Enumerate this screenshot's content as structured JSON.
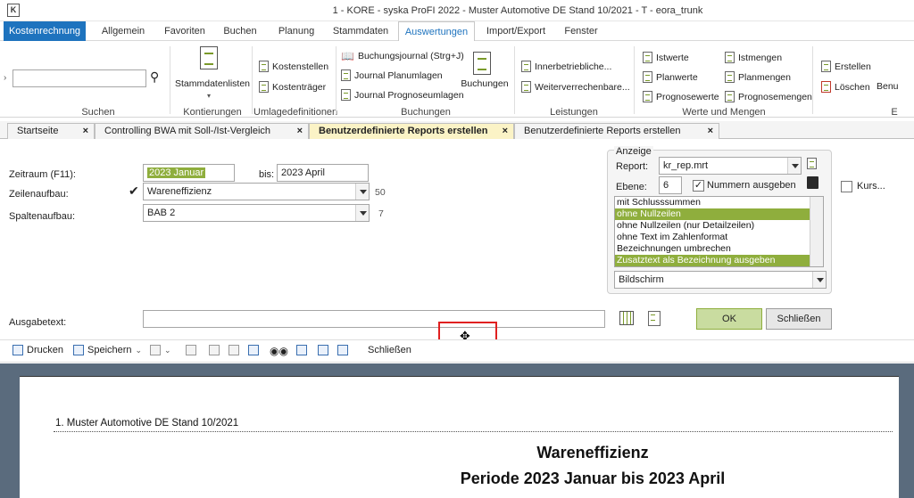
{
  "window": {
    "title": "1 - KORE - syska ProFI 2022 - Muster Automotive DE Stand 10/2021 - T - eora_trunk",
    "logo": "K"
  },
  "ribbon_tabs": [
    "Kostenrechnung",
    "Allgemein",
    "Favoriten",
    "Buchen",
    "Planung",
    "Stammdaten",
    "Auswertungen",
    "Import/Export",
    "Fenster"
  ],
  "ribbon": {
    "groups": {
      "suchen": "Suchen",
      "kontierungen": "Kontierungen",
      "umlagedefinitionen": "Umlagedefinitionen",
      "buchungen": "Buchungen",
      "leistungen": "Leistungen",
      "werte": "Werte und Mengen",
      "e": "E"
    },
    "items": {
      "stammdatenlisten": "Stammdatenlisten",
      "kostenstellen": "Kostenstellen",
      "kostentraeger": "Kostenträger",
      "buchungsjournal": "Buchungsjournal (Strg+J)",
      "journal_plan": "Journal Planumlagen",
      "journal_prog": "Journal Prognoseumlagen",
      "buchungen": "Buchungen",
      "innerbetr": "Innerbetriebliche...",
      "weiterverr": "Weiterverrechenbare...",
      "istwerte": "Istwerte",
      "istmengen": "Istmengen",
      "planwerte": "Planwerte",
      "planmengen": "Planmengen",
      "prognosewerte": "Prognosewerte",
      "prognosemengen": "Prognosemengen",
      "erstellen": "Erstellen",
      "loeschen": "Löschen",
      "benu": "Benu"
    }
  },
  "doc_tabs": [
    {
      "label": "Startseite",
      "close": "×"
    },
    {
      "label": "Controlling BWA mit Soll-/Ist-Vergleich",
      "close": "×"
    },
    {
      "label": "Benutzerdefinierte Reports erstellen",
      "close": "×"
    },
    {
      "label": "Benutzerdefinierte Reports erstellen",
      "close": "×"
    }
  ],
  "form": {
    "zeitraum_label": "Zeitraum (F11):",
    "zeitraum_from": "2023  Januar",
    "bis_label": "bis:",
    "zeitraum_to": "2023  April",
    "zeilen_label": "Zeilenaufbau:",
    "zeilen_value": "Wareneffizienz",
    "zeilen_count": "50",
    "spalten_label": "Spaltenaufbau:",
    "spalten_value": "BAB 2",
    "spalten_count": "7",
    "ausgabe_label": "Ausgabetext:",
    "ausgabe_value": ""
  },
  "anzeige": {
    "title": "Anzeige",
    "report_label": "Report:",
    "report_value": "kr_rep.mrt",
    "ebene_label": "Ebene:",
    "ebene_value": "6",
    "nummern_label": "Nummern ausgeben",
    "kurs_label": "Kurs...",
    "options": [
      {
        "label": "mit Schlusssummen",
        "selected": false
      },
      {
        "label": "ohne Nullzeilen",
        "selected": true
      },
      {
        "label": "ohne Nullzeilen (nur Detailzeilen)",
        "selected": false
      },
      {
        "label": "ohne Text im Zahlenformat",
        "selected": false
      },
      {
        "label": "Bezeichnungen umbrechen",
        "selected": false
      },
      {
        "label": "Zusatztext als Bezeichnung ausgeben",
        "selected": true
      }
    ],
    "output_value": "Bildschirm"
  },
  "buttons": {
    "ok": "OK",
    "schliessen": "Schließen"
  },
  "toolbar": {
    "drucken": "Drucken",
    "speichern": "Speichern",
    "schliessen": "Schließen"
  },
  "report": {
    "company": "1. Muster Automotive DE Stand 10/2021",
    "title": "Wareneffizienz",
    "period": "Periode 2023 Januar bis 2023 April"
  },
  "colors": {
    "accent": "#1e73be",
    "selection": "#8fae3d",
    "active_tab": "#fbf3c6",
    "highlight_box": "#e02020"
  }
}
